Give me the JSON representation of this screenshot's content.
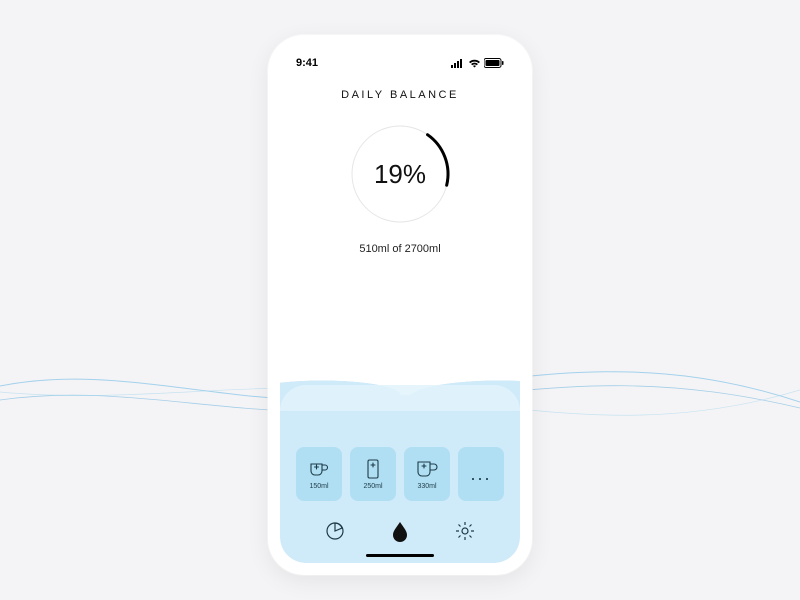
{
  "statusbar": {
    "time": "9:41"
  },
  "header": {
    "title": "DAILY BALANCE"
  },
  "chart_data": {
    "type": "pie",
    "title": "Daily Balance",
    "percent_label": "19%",
    "progress_percent": 19,
    "consumed_ml": 510,
    "goal_ml": 2700,
    "summary": "510ml of 2700ml"
  },
  "quick_add": [
    {
      "label": "150ml",
      "icon": "small-cup"
    },
    {
      "label": "250ml",
      "icon": "glass"
    },
    {
      "label": "330ml",
      "icon": "mug"
    }
  ],
  "more_button": {
    "label": "..."
  },
  "nav": {
    "stats": "stats",
    "home": "home",
    "settings": "settings"
  },
  "colors": {
    "water": "#cfeaf8",
    "water_light": "#e2f3fb",
    "card": "#b0dff3",
    "ring_track": "#e6e6e6",
    "ring_progress": "#000000"
  }
}
